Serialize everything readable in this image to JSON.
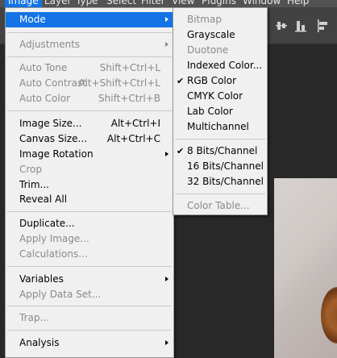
{
  "menubar": {
    "items": [
      "Image",
      "Layer",
      "Type",
      "Select",
      "Filter",
      "View",
      "Plugins",
      "Window",
      "Help"
    ]
  },
  "image_menu": {
    "items": [
      {
        "label": "Mode",
        "shortcut": "",
        "enabled": true,
        "submenu": true,
        "highlighted": true
      },
      {
        "label": "Adjustments",
        "shortcut": "",
        "enabled": false,
        "submenu": true
      },
      {
        "label": "Auto Tone",
        "shortcut": "Shift+Ctrl+L",
        "enabled": false
      },
      {
        "label": "Auto Contrast",
        "shortcut": "Alt+Shift+Ctrl+L",
        "enabled": false
      },
      {
        "label": "Auto Color",
        "shortcut": "Shift+Ctrl+B",
        "enabled": false
      },
      {
        "label": "Image Size...",
        "shortcut": "Alt+Ctrl+I",
        "enabled": true
      },
      {
        "label": "Canvas Size...",
        "shortcut": "Alt+Ctrl+C",
        "enabled": true
      },
      {
        "label": "Image Rotation",
        "shortcut": "",
        "enabled": true,
        "submenu": true
      },
      {
        "label": "Crop",
        "shortcut": "",
        "enabled": false
      },
      {
        "label": "Trim...",
        "shortcut": "",
        "enabled": true
      },
      {
        "label": "Reveal All",
        "shortcut": "",
        "enabled": true
      },
      {
        "label": "Duplicate...",
        "shortcut": "",
        "enabled": true
      },
      {
        "label": "Apply Image...",
        "shortcut": "",
        "enabled": false
      },
      {
        "label": "Calculations...",
        "shortcut": "",
        "enabled": false
      },
      {
        "label": "Variables",
        "shortcut": "",
        "enabled": true,
        "submenu": true
      },
      {
        "label": "Apply Data Set...",
        "shortcut": "",
        "enabled": false
      },
      {
        "label": "Trap...",
        "shortcut": "",
        "enabled": false
      },
      {
        "label": "Analysis",
        "shortcut": "",
        "enabled": true,
        "submenu": true
      }
    ]
  },
  "mode_submenu": {
    "items": [
      {
        "label": "Bitmap",
        "enabled": false,
        "checked": false
      },
      {
        "label": "Grayscale",
        "enabled": true,
        "checked": false
      },
      {
        "label": "Duotone",
        "enabled": false,
        "checked": false
      },
      {
        "label": "Indexed Color...",
        "enabled": true,
        "checked": false
      },
      {
        "label": "RGB Color",
        "enabled": true,
        "checked": true
      },
      {
        "label": "CMYK Color",
        "enabled": true,
        "checked": false
      },
      {
        "label": "Lab Color",
        "enabled": true,
        "checked": false
      },
      {
        "label": "Multichannel",
        "enabled": true,
        "checked": false
      },
      {
        "label": "8 Bits/Channel",
        "enabled": true,
        "checked": true
      },
      {
        "label": "16 Bits/Channel",
        "enabled": true,
        "checked": false
      },
      {
        "label": "32 Bits/Channel",
        "enabled": true,
        "checked": false
      },
      {
        "label": "Color Table...",
        "enabled": false,
        "checked": false
      }
    ]
  },
  "colors": {
    "highlight": "#1473e6",
    "menu_bg": "#f0f0f0",
    "disabled_text": "#8a8a8a",
    "menubar_bg": "#535353"
  }
}
